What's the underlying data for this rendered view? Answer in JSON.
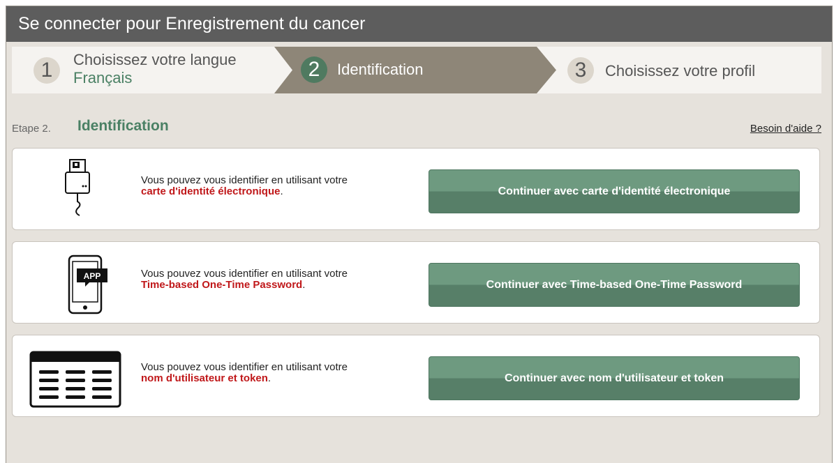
{
  "window": {
    "title": "Se connecter pour Enregistrement du cancer"
  },
  "steps": [
    {
      "number": "1",
      "title": "Choisissez votre langue",
      "subtitle": "Français"
    },
    {
      "number": "2",
      "title": "Identification"
    },
    {
      "number": "3",
      "title": "Choisissez votre profil"
    }
  ],
  "heading": {
    "step_label": "Etape 2.",
    "title": "Identification",
    "help_link": "Besoin d'aide ?"
  },
  "options": [
    {
      "text": "Vous pouvez vous identifier en utilisant votre",
      "highlight": "carte d'identité électronique",
      "suffix": ".",
      "button": "Continuer avec carte d'identité électronique",
      "icon": "card-reader-icon"
    },
    {
      "text": "Vous pouvez vous identifier en utilisant votre",
      "highlight": "Time-based One-Time Password",
      "suffix": ".",
      "button": "Continuer avec Time-based One-Time Password",
      "icon": "phone-app-icon",
      "icon_text": "APP"
    },
    {
      "text": "Vous pouvez vous identifier en utilisant votre",
      "highlight": "nom d'utilisateur et token",
      "suffix": ".",
      "button": "Continuer avec nom d'utilisateur et token",
      "icon": "token-grid-icon"
    }
  ],
  "colors": {
    "accent_green": "#4a8064",
    "button_green": "#6e9a80",
    "highlight_red": "#c0181a",
    "titlebar": "#5d5d5d",
    "active_step": "#8e8678"
  }
}
